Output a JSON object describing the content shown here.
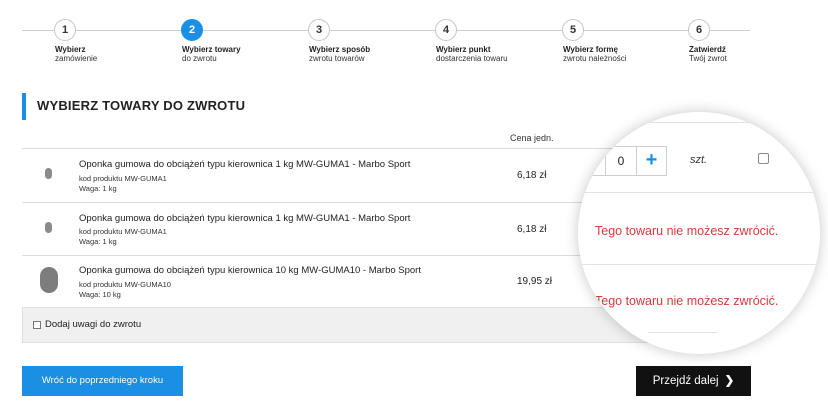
{
  "steps": [
    {
      "num": "1",
      "title": "Wybierz",
      "sub": "zamówienie"
    },
    {
      "num": "2",
      "title": "Wybierz towary",
      "sub": "do zwrotu"
    },
    {
      "num": "3",
      "title": "Wybierz sposób",
      "sub": "zwrotu towarów"
    },
    {
      "num": "4",
      "title": "Wybierz punkt",
      "sub": "dostarczenia towaru"
    },
    {
      "num": "5",
      "title": "Wybierz formę",
      "sub": "zwrotu należności"
    },
    {
      "num": "6",
      "title": "Zatwierdź",
      "sub": "Twój zwrot"
    }
  ],
  "section_title": "WYBIERZ TOWARY DO ZWROTU",
  "columns": {
    "price": "Cena jedn."
  },
  "products": [
    {
      "name": "Oponka gumowa do obciążeń typu kierownica 1 kg MW-GUMA1 - Marbo Sport",
      "code": "kod produktu MW-GUMA1",
      "weight": "Waga: 1 kg",
      "price": "6,18 zł"
    },
    {
      "name": "Oponka gumowa do obciążeń typu kierownica 1 kg MW-GUMA1 - Marbo Sport",
      "code": "kod produktu MW-GUMA1",
      "weight": "Waga: 1 kg",
      "price": "6,18 zł"
    },
    {
      "name": "Oponka gumowa do obciążeń typu kierownica 10 kg MW-GUMA10 - Marbo Sport",
      "code": "kod produktu MW-GUMA10",
      "weight": "Waga: 10 kg",
      "price": "19,95 zł"
    }
  ],
  "quantity": {
    "value": "0",
    "plus": "+",
    "unit": "szt."
  },
  "cannot_return": "Tego towaru nie możesz zwrócić.",
  "notes_label": "Dodaj uwagi do zwrotu",
  "back_button": "Wróć do poprzedniego kroku",
  "next_button": "Przejdź dalej",
  "colors": {
    "accent": "#1a8fe3",
    "error": "#d63b3b",
    "dark": "#111111"
  }
}
